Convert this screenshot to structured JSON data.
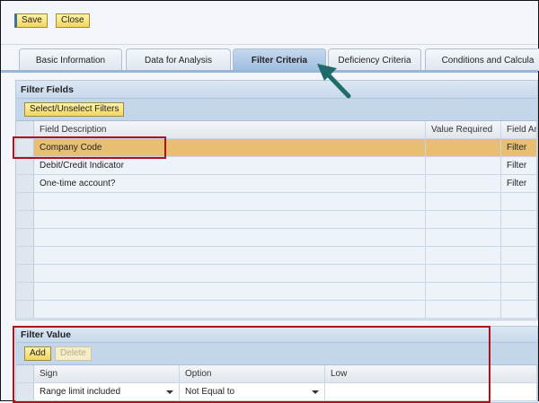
{
  "toolbar": {
    "save": "Save",
    "close": "Close"
  },
  "tabs": [
    {
      "label": "Basic Information"
    },
    {
      "label": "Data for Analysis"
    },
    {
      "label": "Filter Criteria",
      "active": true
    },
    {
      "label": "Deficiency Criteria"
    },
    {
      "label": "Conditions and Calcula"
    }
  ],
  "filter_fields": {
    "title": "Filter Fields",
    "select_button": "Select/Unselect Filters",
    "columns": [
      "Field Description",
      "Value Required",
      "Field An"
    ],
    "rows": [
      {
        "desc": "Company Code",
        "req": "",
        "field": "Filter",
        "highlighted": true
      },
      {
        "desc": "Debit/Credit Indicator",
        "req": "",
        "field": "Filter"
      },
      {
        "desc": "One-time account?",
        "req": "",
        "field": "Filter"
      }
    ]
  },
  "filter_value": {
    "title": "Filter Value",
    "add": "Add",
    "delete": "Delete",
    "columns": [
      "Sign",
      "Option",
      "Low"
    ],
    "row": {
      "sign": "Range limit included",
      "option": "Not Equal to",
      "low": ""
    }
  },
  "colors": {
    "highlight": "#e8bf72",
    "annotation": "#b0101a",
    "arrow": "#1f6a6a"
  }
}
